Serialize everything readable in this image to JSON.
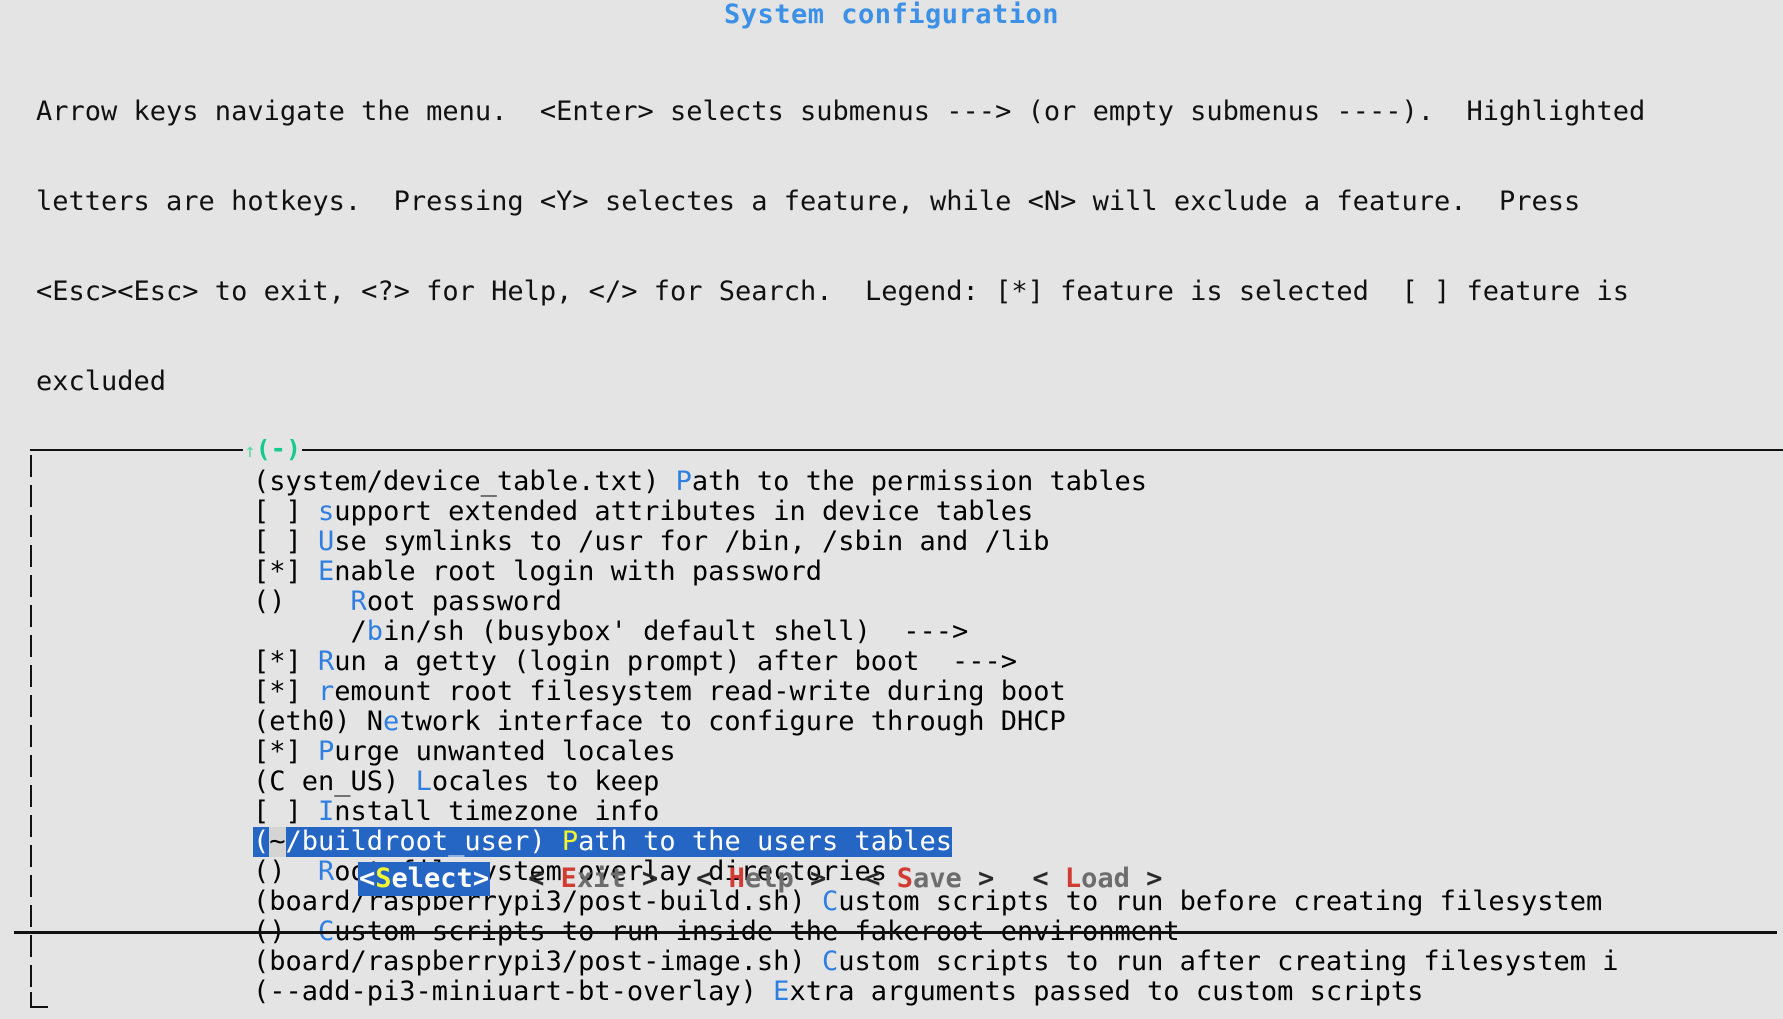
{
  "window": {
    "title": "System configuration"
  },
  "help": {
    "lines": [
      "Arrow keys navigate the menu.  <Enter> selects submenus ---> (or empty submenus ----).  Highlighted",
      "letters are hotkeys.  Pressing <Y> selectes a feature, while <N> will exclude a feature.  Press",
      "<Esc><Esc> to exit, <?> for Help, </> for Search.  Legend: [*] feature is selected  [ ] feature is",
      "excluded"
    ]
  },
  "frame": {
    "scroll_indicator": {
      "arrow": "↑",
      "marker": "(-)"
    }
  },
  "menu": {
    "selected_index": 12,
    "cursor_char": "~",
    "items": [
      {
        "prefix": "(system/device_table.txt) ",
        "hotkey": "P",
        "label": "ath to the permission tables"
      },
      {
        "prefix": "[ ] ",
        "hotkey": "s",
        "label": "upport extended attributes in device tables"
      },
      {
        "prefix": "[ ] ",
        "hotkey": "U",
        "label": "se symlinks to /usr for /bin, /sbin and /lib"
      },
      {
        "prefix": "[*] ",
        "hotkey": "E",
        "label": "nable root login with password"
      },
      {
        "prefix": "()    ",
        "hotkey": "R",
        "label": "oot password"
      },
      {
        "prefix": "      /",
        "hotkey": "b",
        "label": "in/sh (busybox' default shell)  --->"
      },
      {
        "prefix": "[*] ",
        "hotkey": "R",
        "label": "un a getty (login prompt) after boot  --->"
      },
      {
        "prefix": "[*] ",
        "hotkey": "r",
        "label": "emount root filesystem read-write during boot"
      },
      {
        "prefix": "(eth0) N",
        "hotkey": "e",
        "label": "twork interface to configure through DHCP"
      },
      {
        "prefix": "[*] ",
        "hotkey": "P",
        "label": "urge unwanted locales"
      },
      {
        "prefix": "(C en_US) ",
        "hotkey": "L",
        "label": "ocales to keep"
      },
      {
        "prefix": "[ ] ",
        "hotkey": "I",
        "label": "nstall timezone info"
      },
      {
        "prefix": "(~/buildroot_user) ",
        "hotkey": "P",
        "label": "ath to the users tables"
      },
      {
        "prefix": "()  ",
        "hotkey": "R",
        "label": "oot filesystem overlay directories"
      },
      {
        "prefix": "(board/raspberrypi3/post-build.sh) ",
        "hotkey": "C",
        "label": "ustom scripts to run before creating filesystem"
      },
      {
        "prefix": "()  ",
        "hotkey": "C",
        "label": "ustom scripts to run inside the fakeroot environment"
      },
      {
        "prefix": "(board/raspberrypi3/post-image.sh) ",
        "hotkey": "C",
        "label": "ustom scripts to run after creating filesystem i"
      },
      {
        "prefix": "(--add-pi3-miniuart-bt-overlay) ",
        "hotkey": "E",
        "label": "xtra arguments passed to custom scripts"
      }
    ]
  },
  "buttons": [
    {
      "name": "select",
      "open": "<",
      "hotkey": "S",
      "rest": "elect",
      "close": ">",
      "selected": true
    },
    {
      "name": "exit",
      "open": "< ",
      "hotkey": "E",
      "rest": "xit",
      "close": " >",
      "selected": false
    },
    {
      "name": "help",
      "open": "< ",
      "hotkey": "H",
      "rest": "elp",
      "close": " >",
      "selected": false
    },
    {
      "name": "save",
      "open": "< ",
      "hotkey": "S",
      "rest": "ave",
      "close": " >",
      "selected": false
    },
    {
      "name": "load",
      "open": "< ",
      "hotkey": "L",
      "rest": "oad",
      "close": " >",
      "selected": false
    }
  ],
  "colors": {
    "background": "#e4e4e4",
    "title": "#3c91e6",
    "hotkey": "#2f7fe0",
    "highlight_bg": "#2566c4",
    "highlight_hotkey": "#f4f430",
    "scroll_marker": "#16c98d",
    "button_hotkey": "#d13b32",
    "button_text": "#6d6d6d"
  }
}
